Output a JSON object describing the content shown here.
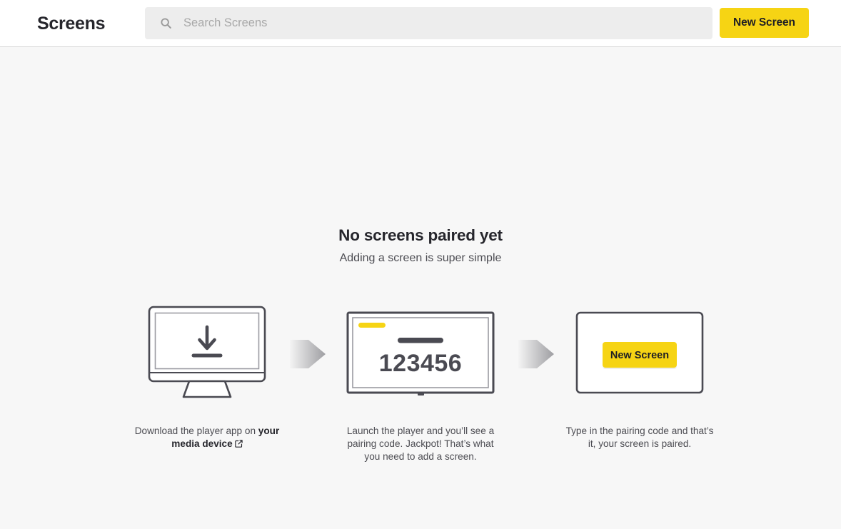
{
  "header": {
    "brand_title": "Screens",
    "search": {
      "placeholder": "Search Screens",
      "value": "",
      "icon": "search-icon"
    },
    "new_screen_label": "New Screen"
  },
  "empty_state": {
    "title": "No screens paired yet",
    "subtitle": "Adding a screen is super simple",
    "steps": [
      {
        "art": "monitor-download-icon",
        "caption_prefix": "Download the player app on ",
        "caption_link": "your media device",
        "caption_suffix": "",
        "link_icon": "external-link-icon"
      },
      {
        "art": "tv-pairing-code-icon",
        "pairing_code": "123456",
        "caption_prefix": "Launch the player and you’ll see a pairing code. Jackpot! That’s what you need to add a screen.",
        "caption_link": "",
        "caption_suffix": ""
      },
      {
        "art": "new-screen-dialog-icon",
        "button_label": "New Screen",
        "caption_prefix": "Type in the pairing code and that’s it, your screen is paired.",
        "caption_link": "",
        "caption_suffix": ""
      }
    ]
  },
  "colors": {
    "accent_yellow": "#f6d414",
    "page_background": "#f7f7f7",
    "header_background": "#ffffff",
    "search_background": "#ededed",
    "outline_gray": "#4a4a52",
    "text_dark": "#26262c",
    "text_muted": "#4c4c52"
  }
}
